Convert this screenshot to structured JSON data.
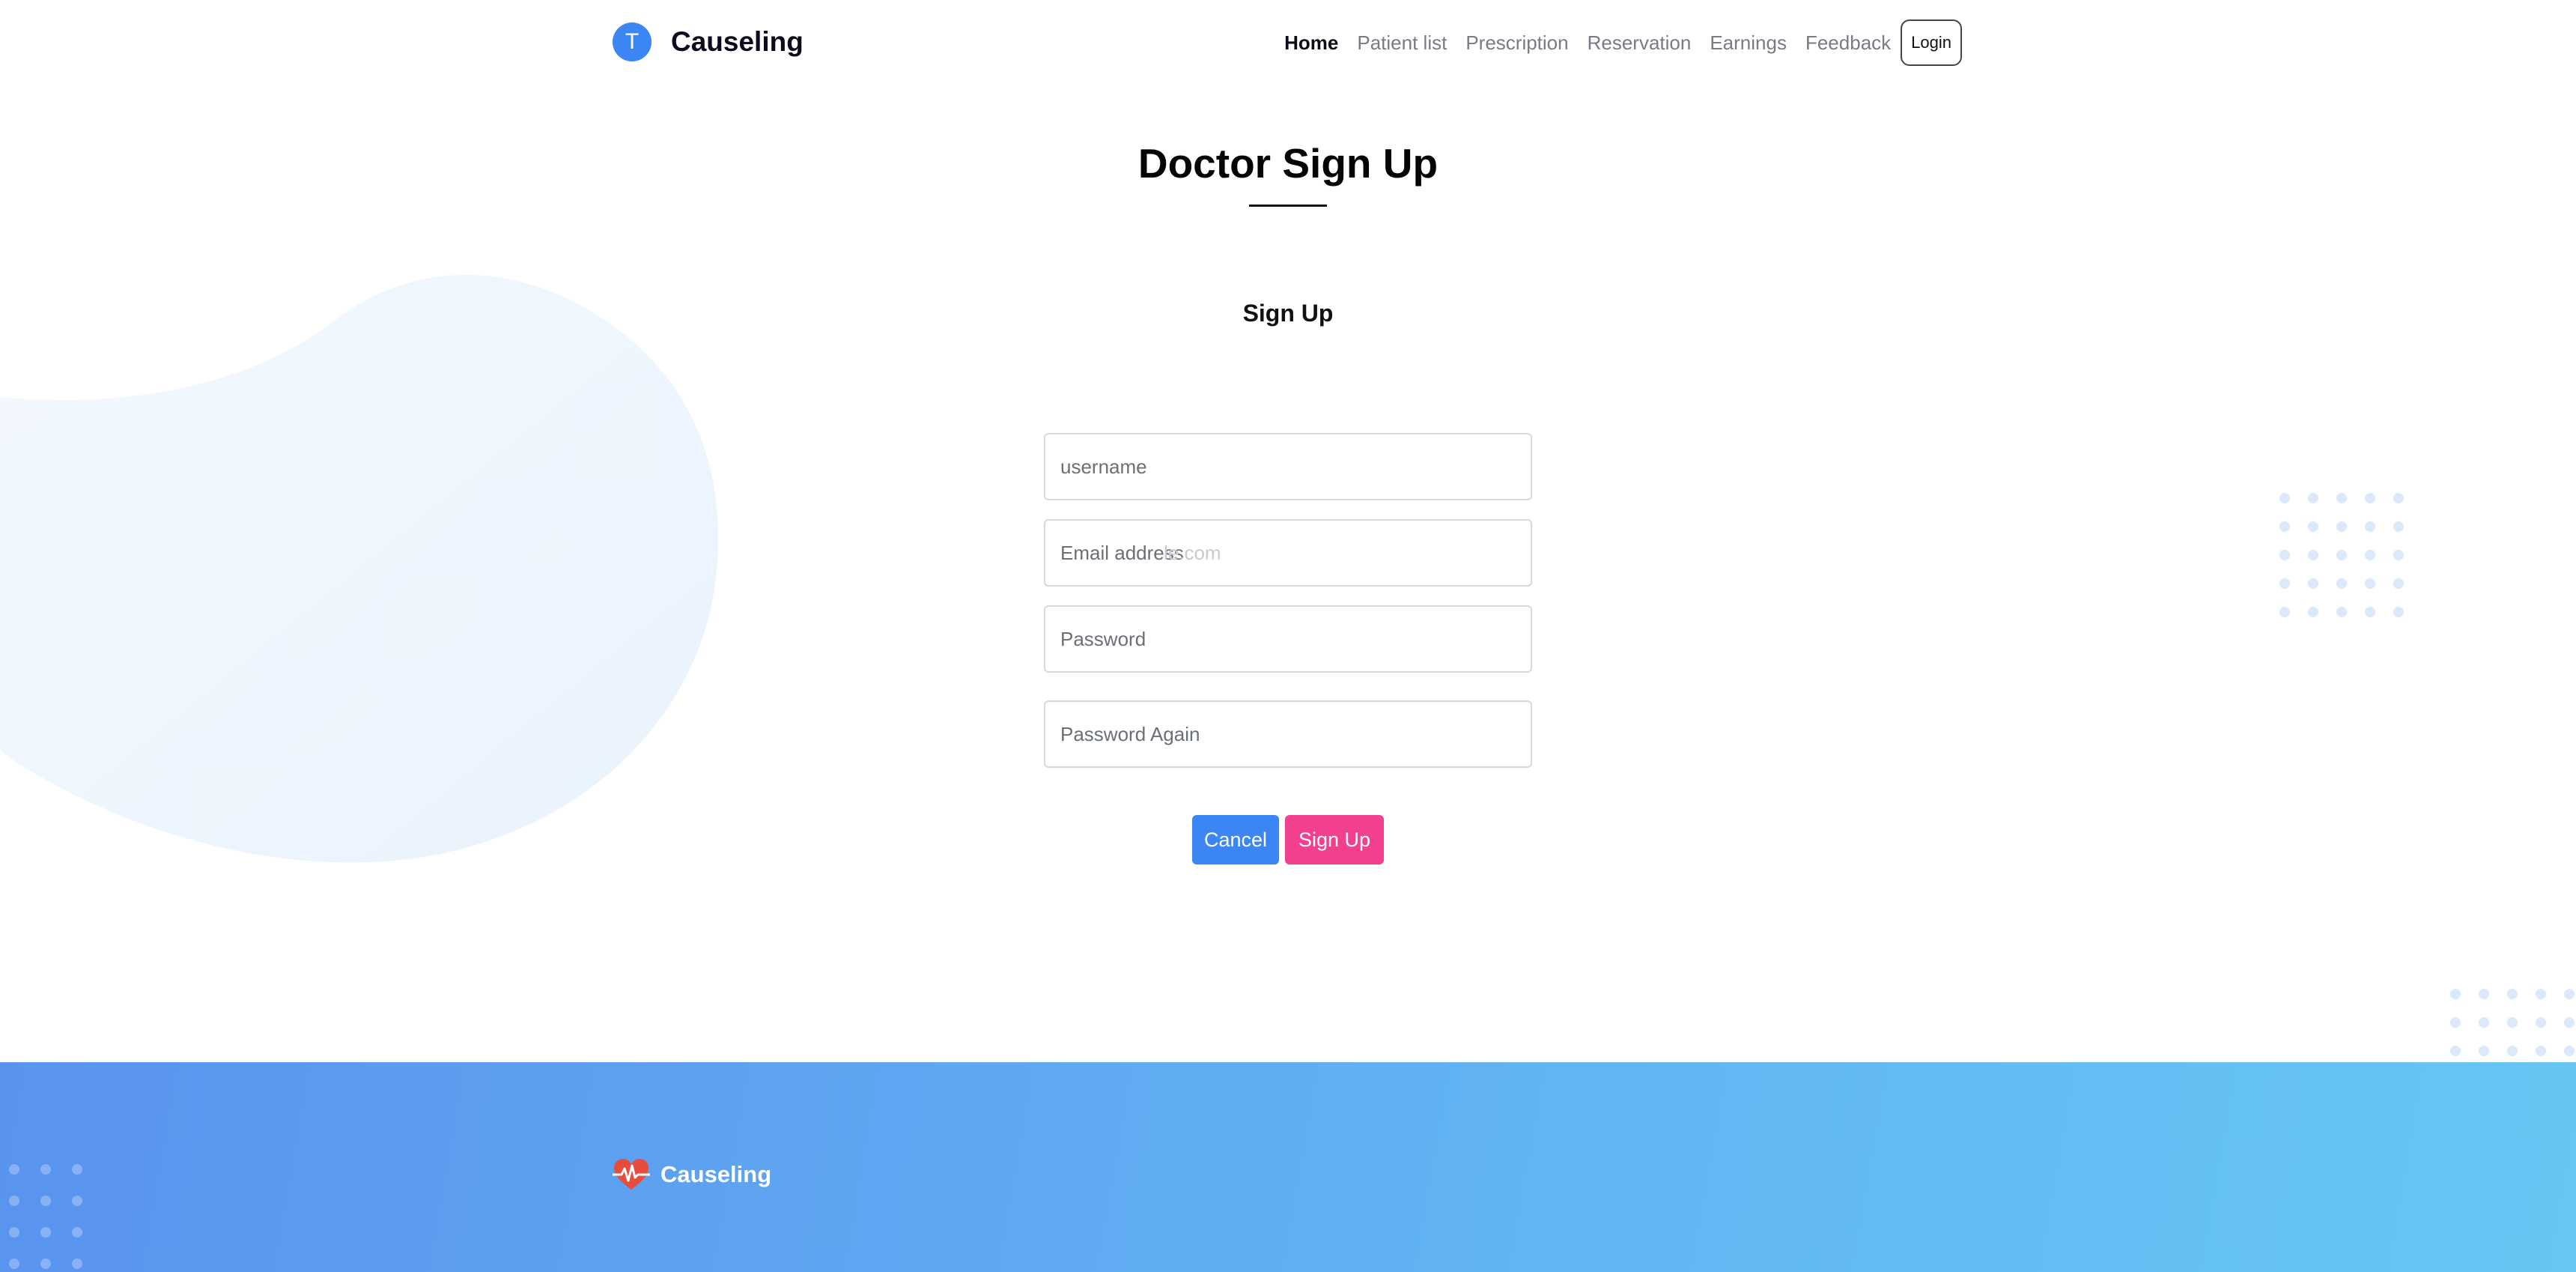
{
  "header": {
    "logo_letter": "T",
    "brand_name": "Causeling",
    "nav": [
      {
        "label": "Home",
        "active": true
      },
      {
        "label": "Patient list",
        "active": false
      },
      {
        "label": "Prescription",
        "active": false
      },
      {
        "label": "Reservation",
        "active": false
      },
      {
        "label": "Earnings",
        "active": false
      },
      {
        "label": "Feedback",
        "active": false
      }
    ],
    "login_label": "Login"
  },
  "main": {
    "title": "Doctor Sign Up",
    "subtitle": "Sign Up",
    "form": {
      "username_placeholder": "username",
      "email_placeholder": "Email address",
      "email_ghost_text": "le.com",
      "password_placeholder": "Password",
      "password_again_placeholder": "Password Again"
    },
    "cancel_label": "Cancel",
    "signup_label": "Sign Up"
  },
  "footer": {
    "brand_name": "Causeling",
    "icon": "heart-pulse-icon"
  },
  "colors": {
    "primary_blue": "#3b86f2",
    "accent_pink": "#f23f8e",
    "footer_gradient_start": "#5993ef",
    "footer_gradient_end": "#67c6f4",
    "blob": "#edf5fe",
    "dots": "#dce9fb"
  }
}
